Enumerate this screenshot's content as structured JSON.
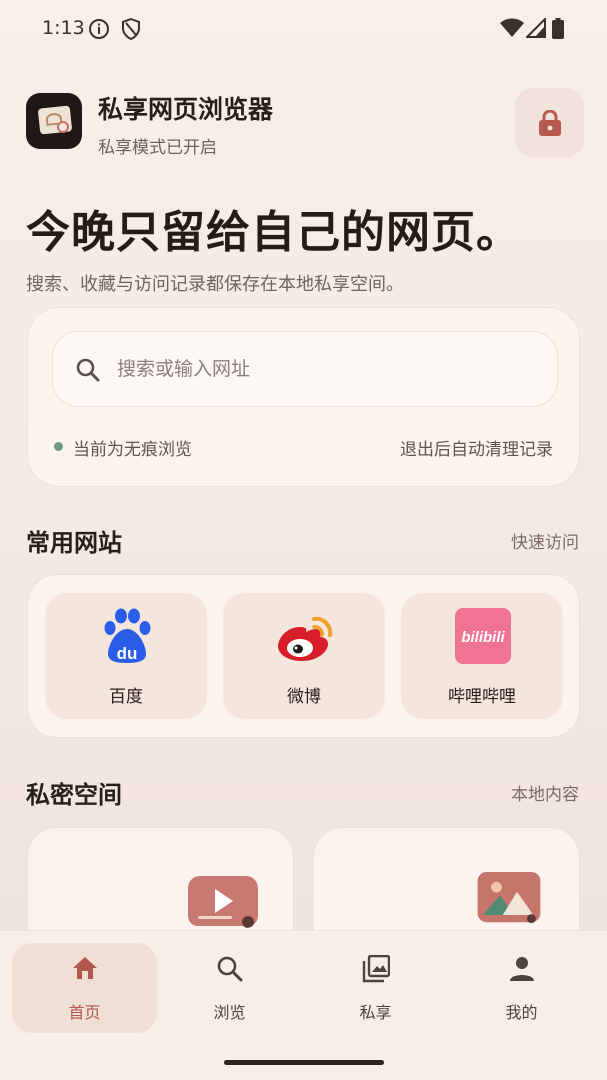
{
  "status_bar": {
    "time": "1:13",
    "icons": [
      "info-icon",
      "shield-icon",
      "wifi-icon",
      "signal-icon",
      "battery-icon"
    ]
  },
  "header": {
    "app_name": "私享网页浏览器",
    "subtitle": "私享模式已开启",
    "lock_icon": "lock-icon"
  },
  "hero": {
    "title": "今晚只留给自己的网页。",
    "subtitle": "搜索、收藏与访问记录都保存在本地私享空间。"
  },
  "search": {
    "placeholder": "搜索或输入网址",
    "value": "",
    "incognito_status": "当前为无痕浏览",
    "auto_clear": "退出后自动清理记录"
  },
  "sites_section": {
    "title": "常用网站",
    "link": "快速访问",
    "items": [
      {
        "label": "百度",
        "icon": "baidu-logo"
      },
      {
        "label": "微博",
        "icon": "weibo-logo"
      },
      {
        "label": "哔哩哔哩",
        "icon": "bilibili-logo"
      }
    ]
  },
  "private_section": {
    "title": "私密空间",
    "link": "本地内容",
    "items": [
      {
        "icon": "video-icon"
      },
      {
        "icon": "photo-icon"
      }
    ]
  },
  "bottom_nav": {
    "active": 0,
    "items": [
      {
        "label": "首页",
        "icon": "home-icon"
      },
      {
        "label": "浏览",
        "icon": "search-icon"
      },
      {
        "label": "私享",
        "icon": "gallery-icon"
      },
      {
        "label": "我的",
        "icon": "person-icon"
      }
    ]
  },
  "colors": {
    "accent": "#b0574f",
    "background": "#f5ece6",
    "card": "#fbf4ee",
    "tile": "#f4e6dd",
    "incognito_dot": "#6f9a7f"
  }
}
